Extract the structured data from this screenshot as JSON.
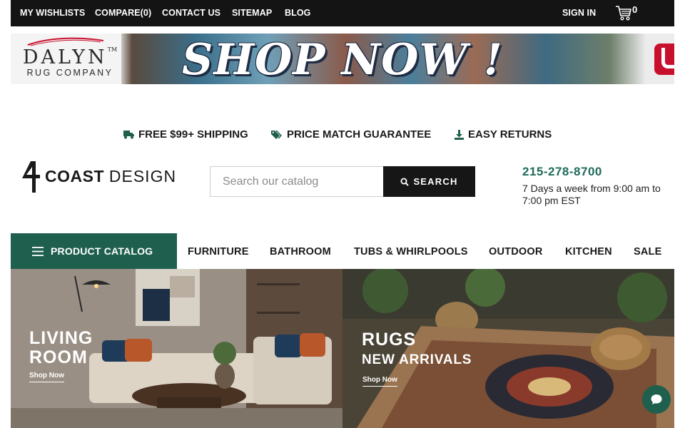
{
  "topbar": {
    "links": [
      "MY WISHLISTS",
      "COMPARE(0)",
      "CONTACT US",
      "SITEMAP",
      "BLOG"
    ],
    "sign_in": "SIGN IN",
    "cart_count": "0"
  },
  "banner": {
    "brand_name": "DALYN",
    "brand_tm": "TM",
    "brand_sub": "RUG COMPANY",
    "headline": "SHOP NOW !"
  },
  "perks": [
    {
      "label": "FREE $99+ SHIPPING",
      "icon": "truck-icon"
    },
    {
      "label": "PRICE MATCH GUARANTEE",
      "icon": "tags-icon"
    },
    {
      "label": "EASY RETURNS",
      "icon": "download-icon"
    }
  ],
  "header": {
    "logo_bold": "COAST",
    "logo_light": "DESIGN",
    "search_placeholder": "Search our catalog",
    "search_value": "",
    "search_button": "SEARCH",
    "phone": "215-278-8700",
    "hours": "7 Days a week from 9:00 am to 7:00 pm EST"
  },
  "nav": {
    "catalog_label": "PRODUCT CATALOG",
    "items": [
      "FURNITURE",
      "BATHROOM",
      "TUBS & WHIRLPOOLS",
      "OUTDOOR",
      "KITCHEN",
      "SALE"
    ]
  },
  "hero": [
    {
      "title": "LIVING\nROOM",
      "subtitle": "",
      "cta": "Shop Now"
    },
    {
      "title": "RUGS",
      "subtitle": "NEW ARRIVALS",
      "cta": "Shop Now"
    }
  ],
  "colors": {
    "brand_green": "#1f5f4e",
    "phone_green": "#1f6b5a",
    "topbar_bg": "#141414",
    "search_button_bg": "#161616"
  }
}
